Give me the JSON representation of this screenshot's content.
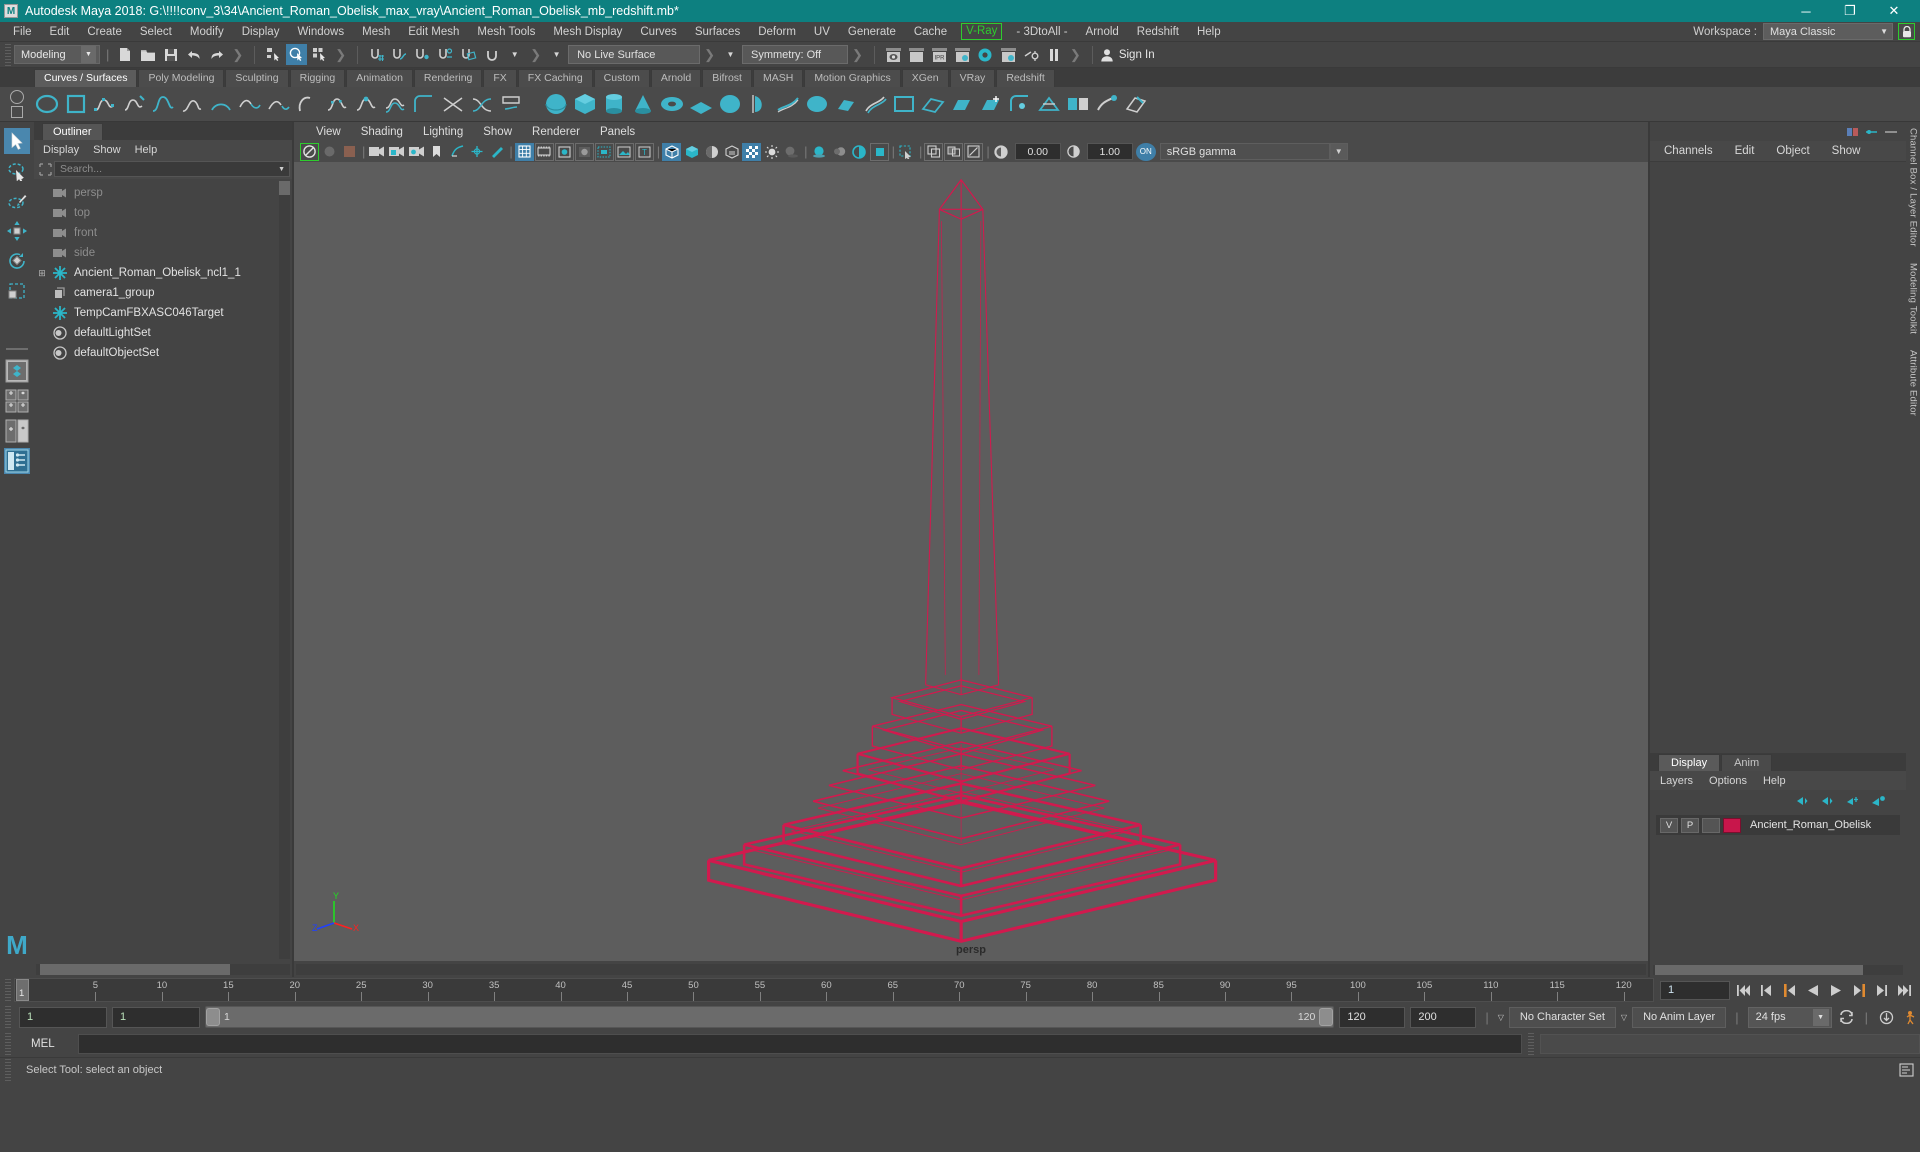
{
  "titlebar": {
    "app_icon": "maya-icon",
    "title": "Autodesk Maya 2018: G:\\!!!!conv_3\\34\\Ancient_Roman_Obelisk_max_vray\\Ancient_Roman_Obelisk_mb_redshift.mb*",
    "minimize": "─",
    "maximize": "❐",
    "close": "✕"
  },
  "menubar": {
    "items": [
      "File",
      "Edit",
      "Create",
      "Select",
      "Modify",
      "Display",
      "Windows",
      "Mesh",
      "Edit Mesh",
      "Mesh Tools",
      "Mesh Display",
      "Curves",
      "Surfaces",
      "Deform",
      "UV",
      "Generate",
      "Cache"
    ],
    "vray": "V-Ray",
    "items_after": [
      "- 3DtoAll -",
      "Arnold",
      "Redshift",
      "Help"
    ],
    "workspace_label": "Workspace :",
    "workspace_value": "Maya Classic",
    "lock_icon": "lock-icon",
    "accent_green": "#2ecc2e"
  },
  "statusline": {
    "mode": "Modeling",
    "live_surface": "No Live Surface",
    "symmetry": "Symmetry: Off",
    "signin": "Sign In",
    "icons": [
      "new-file-icon",
      "open-file-icon",
      "save-file-icon",
      "undo-icon",
      "redo-icon",
      "select-hierarchy-icon",
      "select-object-icon",
      "select-component-icon",
      "snap-grid-icon",
      "snap-curve-icon",
      "snap-point-icon",
      "snap-projected-icon",
      "snap-view-plane-icon",
      "magnet-icon",
      "render-view-icon",
      "render-region-icon",
      "ipr-icon",
      "render-settings-icon",
      "hypershade-icon",
      "render-setup-icon",
      "render-sequence-icon",
      "pause-icon"
    ]
  },
  "shelf": {
    "tabs": [
      "Curves / Surfaces",
      "Poly Modeling",
      "Sculpting",
      "Rigging",
      "Animation",
      "Rendering",
      "FX",
      "FX Caching",
      "Custom",
      "Arnold",
      "Bifrost",
      "MASH",
      "Motion Graphics",
      "XGen",
      "VRay",
      "Redshift"
    ],
    "active_tab": "Curves / Surfaces"
  },
  "toolbox": {
    "items": [
      "select-tool",
      "lasso-select-tool",
      "paint-select-tool",
      "move-tool",
      "rotate-tool",
      "scale-tool",
      "last-tool-used",
      "single-perspective-layout",
      "four-view-layout",
      "persp-outliner-layout",
      "outliner-persp-graph-layout"
    ],
    "active": "select-tool",
    "logo": "M"
  },
  "outliner": {
    "tab": "Outliner",
    "menu": [
      "Display",
      "Show",
      "Help"
    ],
    "search_placeholder": "Search...",
    "filter_icon": "filter-icon",
    "items": [
      {
        "label": "persp",
        "icon": "camera-icon",
        "dim": true,
        "expandable": false
      },
      {
        "label": "top",
        "icon": "camera-icon",
        "dim": true,
        "expandable": false
      },
      {
        "label": "front",
        "icon": "camera-icon",
        "dim": true,
        "expandable": false
      },
      {
        "label": "side",
        "icon": "camera-icon",
        "dim": true,
        "expandable": false
      },
      {
        "label": "Ancient_Roman_Obelisk_ncl1_1",
        "icon": "transform-icon",
        "dim": false,
        "expandable": true
      },
      {
        "label": "camera1_group",
        "icon": "group-icon",
        "dim": false,
        "expandable": false
      },
      {
        "label": "TempCamFBXASC046Target",
        "icon": "transform-icon",
        "dim": false,
        "expandable": false
      },
      {
        "label": "defaultLightSet",
        "icon": "set-icon",
        "dim": false,
        "expandable": false
      },
      {
        "label": "defaultObjectSet",
        "icon": "set-icon",
        "dim": false,
        "expandable": false
      }
    ]
  },
  "viewport": {
    "menu": [
      "View",
      "Shading",
      "Lighting",
      "Show",
      "Renderer",
      "Panels"
    ],
    "exposure_value": "0.00",
    "gamma_value": "1.00",
    "color_mode_toggle": "ON",
    "color_management": "sRGB gamma",
    "camera_label": "persp",
    "background_color": "#5d5d5d",
    "wireframe_color": "#d11a4e",
    "axis": {
      "x": "X",
      "y": "Y",
      "z": "Z",
      "x_color": "#ff2020",
      "y_color": "#20dd20",
      "z_color": "#2040ff"
    }
  },
  "channelbox": {
    "menu": [
      "Channels",
      "Edit",
      "Object",
      "Show"
    ],
    "side_tabs": [
      "Channel Box / Layer Editor",
      "Modeling Toolkit",
      "Attribute Editor"
    ]
  },
  "layers": {
    "tabs": [
      "Display",
      "Anim"
    ],
    "active_tab": "Display",
    "menu": [
      "Layers",
      "Options",
      "Help"
    ],
    "buttons": [
      "move-layer-up-icon",
      "move-layer-down-icon",
      "new-layer-icon",
      "new-layer-from-selected-icon"
    ],
    "rows": [
      {
        "visibility": "V",
        "playback": "P",
        "type": "",
        "color": "#c8164b",
        "name": "Ancient_Roman_Obelisk"
      }
    ]
  },
  "timeline": {
    "current_frame_marker": "1",
    "ticks": [
      5,
      10,
      15,
      20,
      25,
      30,
      35,
      40,
      45,
      50,
      55,
      60,
      65,
      70,
      75,
      80,
      85,
      90,
      95,
      100,
      105,
      110,
      115,
      120
    ],
    "current_frame_field": "1",
    "transport": [
      "go-to-start-icon",
      "step-back-frame-icon",
      "step-back-key-icon",
      "play-backwards-icon",
      "play-forwards-icon",
      "step-forward-key-icon",
      "step-forward-frame-icon",
      "go-to-end-icon"
    ]
  },
  "rangeslider": {
    "anim_start": "1",
    "range_start": "1",
    "bar_start_label": "1",
    "bar_end_label": "120",
    "range_end": "120",
    "anim_end": "200",
    "character_set": "No Character Set",
    "anim_layer": "No Anim Layer",
    "fps": "24 fps",
    "auto_key_icon": "auto-key-icon",
    "anim_prefs_icon": "animation-preferences-icon",
    "playback_loop_icon": "playback-loop-icon"
  },
  "command": {
    "label": "MEL",
    "input_value": "",
    "output_value": ""
  },
  "statusbar": {
    "message": "Select Tool: select an object",
    "icons": [
      "script-editor-icon"
    ]
  }
}
